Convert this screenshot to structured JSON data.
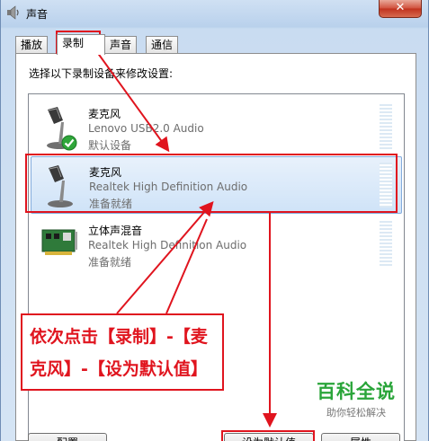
{
  "window": {
    "title": "声音",
    "close": "✕"
  },
  "tabs": [
    {
      "label": "播放",
      "active": false
    },
    {
      "label": "录制",
      "active": true
    },
    {
      "label": "声音",
      "active": false
    },
    {
      "label": "通信",
      "active": false
    }
  ],
  "panel": {
    "instruction": "选择以下录制设备来修改设置:"
  },
  "devices": [
    {
      "name": "麦克风",
      "driver": "Lenovo USB2.0 Audio",
      "status": "默认设备",
      "selected": false,
      "icon": "microphone-icon",
      "badge": "default-check-icon"
    },
    {
      "name": "麦克风",
      "driver": "Realtek High Definition Audio",
      "status": "准备就绪",
      "selected": true,
      "icon": "microphone-icon"
    },
    {
      "name": "立体声混音",
      "driver": "Realtek High Definition Audio",
      "status": "准备就绪",
      "selected": false,
      "icon": "sound-card-icon"
    }
  ],
  "annotation": {
    "line1": "依次点击【录制】-【麦",
    "line2": "克风】-【设为默认值】",
    "color": "#e0141e"
  },
  "buttons": {
    "configure": "配置",
    "set_default": "设为默认值",
    "properties": "属性"
  },
  "watermark": {
    "main": "百科全说",
    "sub": "助你轻松解决"
  }
}
